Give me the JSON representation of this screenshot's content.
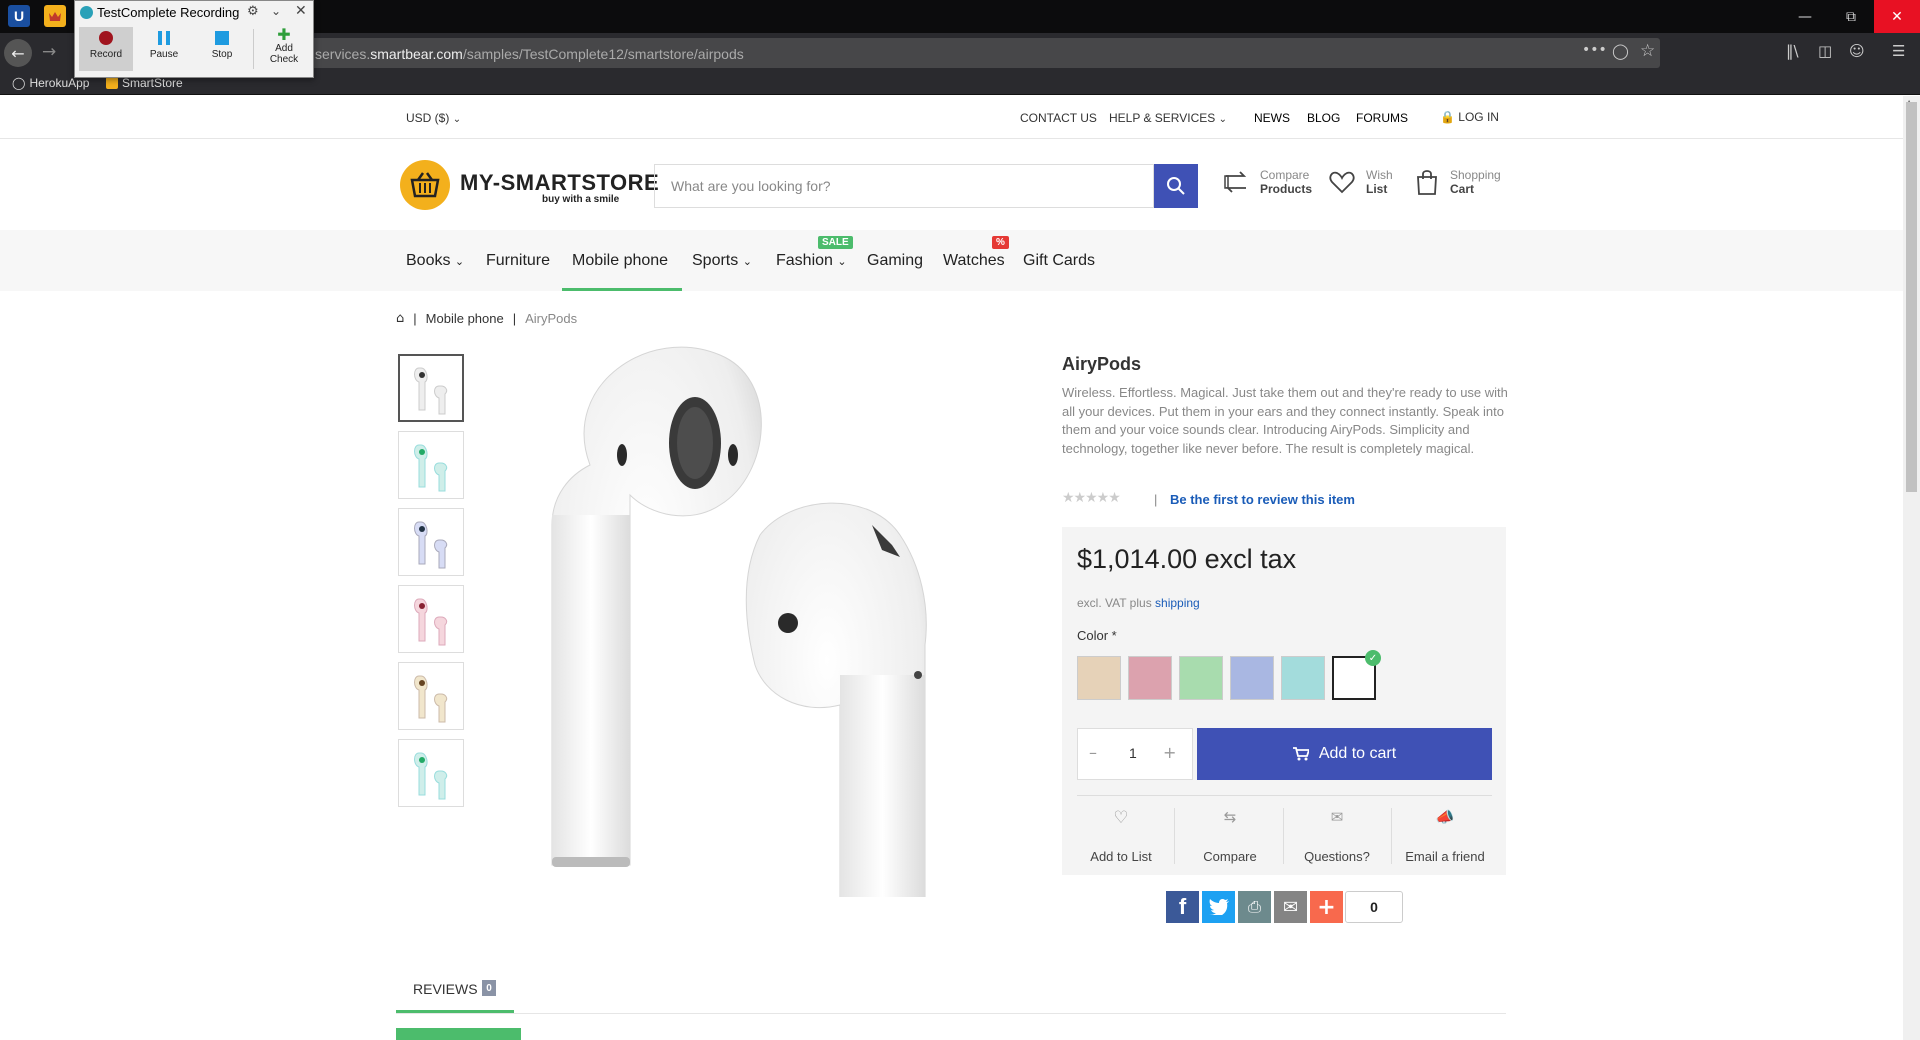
{
  "browser": {
    "url_prefix": "services.",
    "url_domain": "smartbear.com",
    "url_path": "/samples/TestComplete12/smartstore/airpods",
    "bookmarks": [
      "HerokuApp",
      "SmartStore"
    ],
    "tab_logo": "U"
  },
  "recorder": {
    "title": "TestComplete Recording",
    "buttons": [
      "Record",
      "Pause",
      "Stop"
    ],
    "add_check_1": "Add",
    "add_check_2": "Check"
  },
  "topbar": {
    "currency": "USD  ($)",
    "links": [
      "CONTACT US",
      "HELP & SERVICES",
      "NEWS",
      "BLOG",
      "FORUMS"
    ],
    "login": "LOG IN"
  },
  "header": {
    "logo_main": "MY-SMARTSTORE",
    "logo_tagline": "buy with a smile",
    "search_placeholder": "What are you looking for?",
    "compare_small": "Compare",
    "compare_big": "Products",
    "wish_small": "Wish",
    "wish_big": "List",
    "cart_small": "Shopping",
    "cart_big": "Cart"
  },
  "menu": {
    "items": [
      "Books",
      "Furniture",
      "Mobile phone",
      "Sports",
      "Fashion",
      "Gaming",
      "Watches",
      "Gift Cards"
    ],
    "badge_sale": "SALE",
    "badge_percent": "%"
  },
  "breadcrumb": {
    "category": "Mobile phone",
    "current": "AiryPods"
  },
  "product": {
    "name": "AiryPods",
    "description": "Wireless. Effortless. Magical. Just take them out and they're ready to use with all your devices. Put them in your ears and they connect instantly. Speak into them and your voice sounds clear. Introducing AiryPods. Simplicity and technology, together like never before. The result is completely magical.",
    "review_link": "Be the first to review this item",
    "price": "$1,014.00 excl tax",
    "vat_text": "excl. VAT plus ",
    "shipping": "shipping",
    "color_label": "Color *",
    "quantity": "1",
    "add_to_cart": "Add to cart",
    "actions": [
      "Add to List",
      "Compare",
      "Questions?",
      "Email a friend"
    ],
    "share_count": "0"
  },
  "colors": {
    "swatches": [
      "#e6d2b8",
      "#dca2ae",
      "#a8dcae",
      "#a9b7e2",
      "#a3dcdc",
      "#ffffff"
    ],
    "accent": "#3f51b5",
    "green": "#4cbc6c",
    "link": "#1a5cb8"
  },
  "reviews": {
    "label": "REVIEWS",
    "count": "0"
  }
}
